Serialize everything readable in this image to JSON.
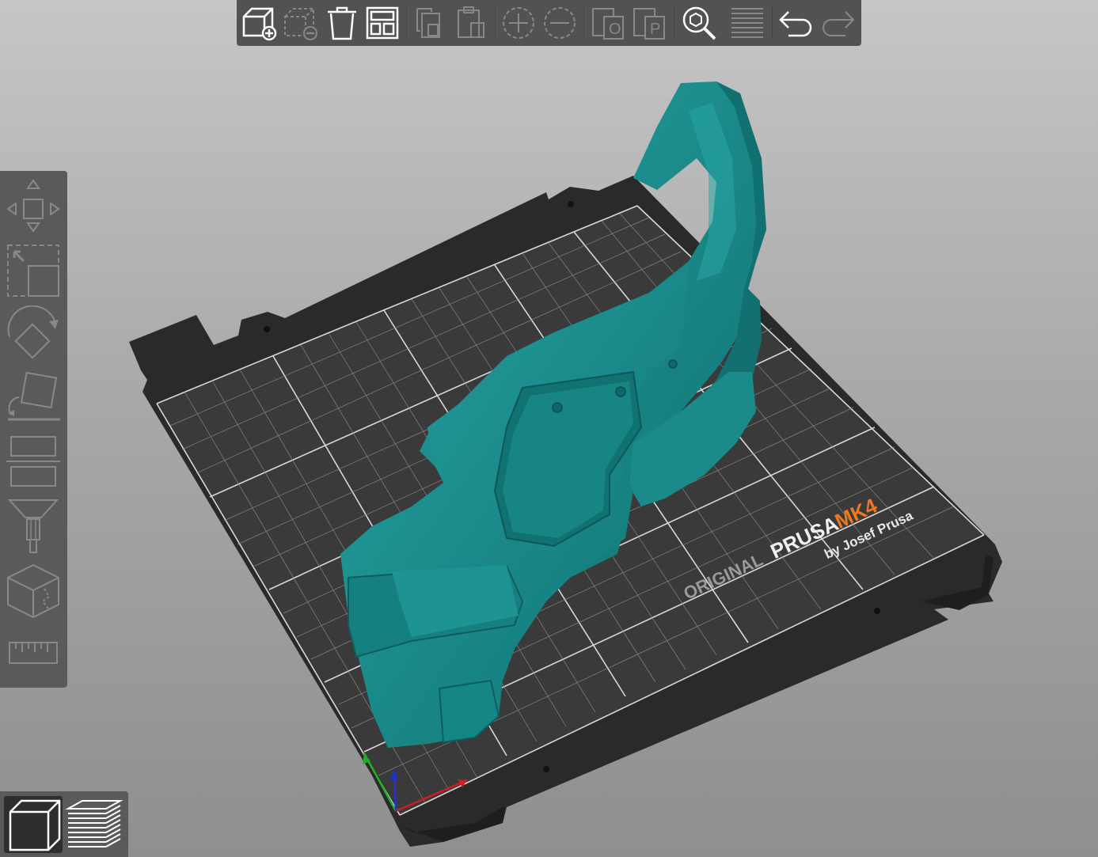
{
  "bed": {
    "logo_original": "ORIGINAL",
    "logo_prusa": "PRUSA",
    "logo_model": "MK4",
    "logo_byline": "by Josef Prusa"
  },
  "colors": {
    "model": "#1d8c8c",
    "bed_sheet": "#3a3a3a",
    "bed_frame": "#2c2c2c",
    "toolbar_bg": "#525252",
    "accent_orange": "#f07822",
    "x_axis": "#d11d1d",
    "y_axis": "#21b021",
    "z_axis": "#2233c8"
  },
  "top_toolbar": {
    "items": [
      {
        "name": "add-object-icon",
        "enabled": true
      },
      {
        "name": "delete-object-icon",
        "enabled": false
      },
      {
        "name": "delete-all-icon",
        "enabled": true
      },
      {
        "name": "arrange-icon",
        "enabled": true
      },
      {
        "name": "copy-icon",
        "enabled": false
      },
      {
        "name": "paste-icon",
        "enabled": false
      },
      {
        "name": "add-instance-icon",
        "enabled": false
      },
      {
        "name": "remove-instance-icon",
        "enabled": false
      },
      {
        "name": "split-to-objects-icon",
        "enabled": false
      },
      {
        "name": "split-to-parts-icon",
        "enabled": false
      },
      {
        "name": "search-icon",
        "enabled": true
      },
      {
        "name": "layers-editing-icon",
        "enabled": false
      },
      {
        "name": "undo-icon",
        "enabled": true
      },
      {
        "name": "redo-icon",
        "enabled": false
      }
    ]
  },
  "left_toolbar": {
    "items": [
      "move-icon",
      "scale-icon",
      "rotate-icon",
      "place-on-face-icon",
      "cut-icon",
      "paint-supports-icon",
      "seam-painting-icon",
      "measure-icon"
    ]
  },
  "view_toolbar": {
    "items": [
      {
        "name": "3d-view-icon",
        "active": true
      },
      {
        "name": "preview-icon",
        "active": false
      }
    ]
  }
}
